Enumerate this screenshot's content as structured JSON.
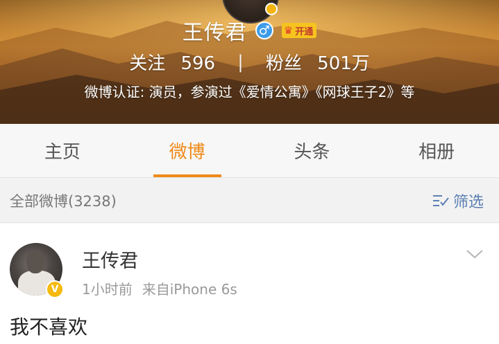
{
  "profile": {
    "name": "王传君",
    "gender_icon": "male-icon",
    "vip_label": "开通",
    "following_label": "关注",
    "following_count": "596",
    "separator": "|",
    "followers_label": "粉丝",
    "followers_count": "501万",
    "verification": "微博认证: 演员，参演过《爱情公寓》《网球王子2》等"
  },
  "tabs": [
    {
      "label": "主页",
      "active": false
    },
    {
      "label": "微博",
      "active": true
    },
    {
      "label": "头条",
      "active": false
    },
    {
      "label": "相册",
      "active": false
    }
  ],
  "filter": {
    "all_label": "全部微博(3238)",
    "filter_button": "筛选"
  },
  "post": {
    "author": "王传君",
    "time": "1小时前",
    "source": "来自iPhone 6s",
    "content": "我不喜欢",
    "verified_badge": "V"
  },
  "colors": {
    "accent": "#ef8a1a",
    "link_blue": "#5b7fb3",
    "vip_gold": "#f6c31f",
    "gender_blue": "#3d9be9"
  }
}
